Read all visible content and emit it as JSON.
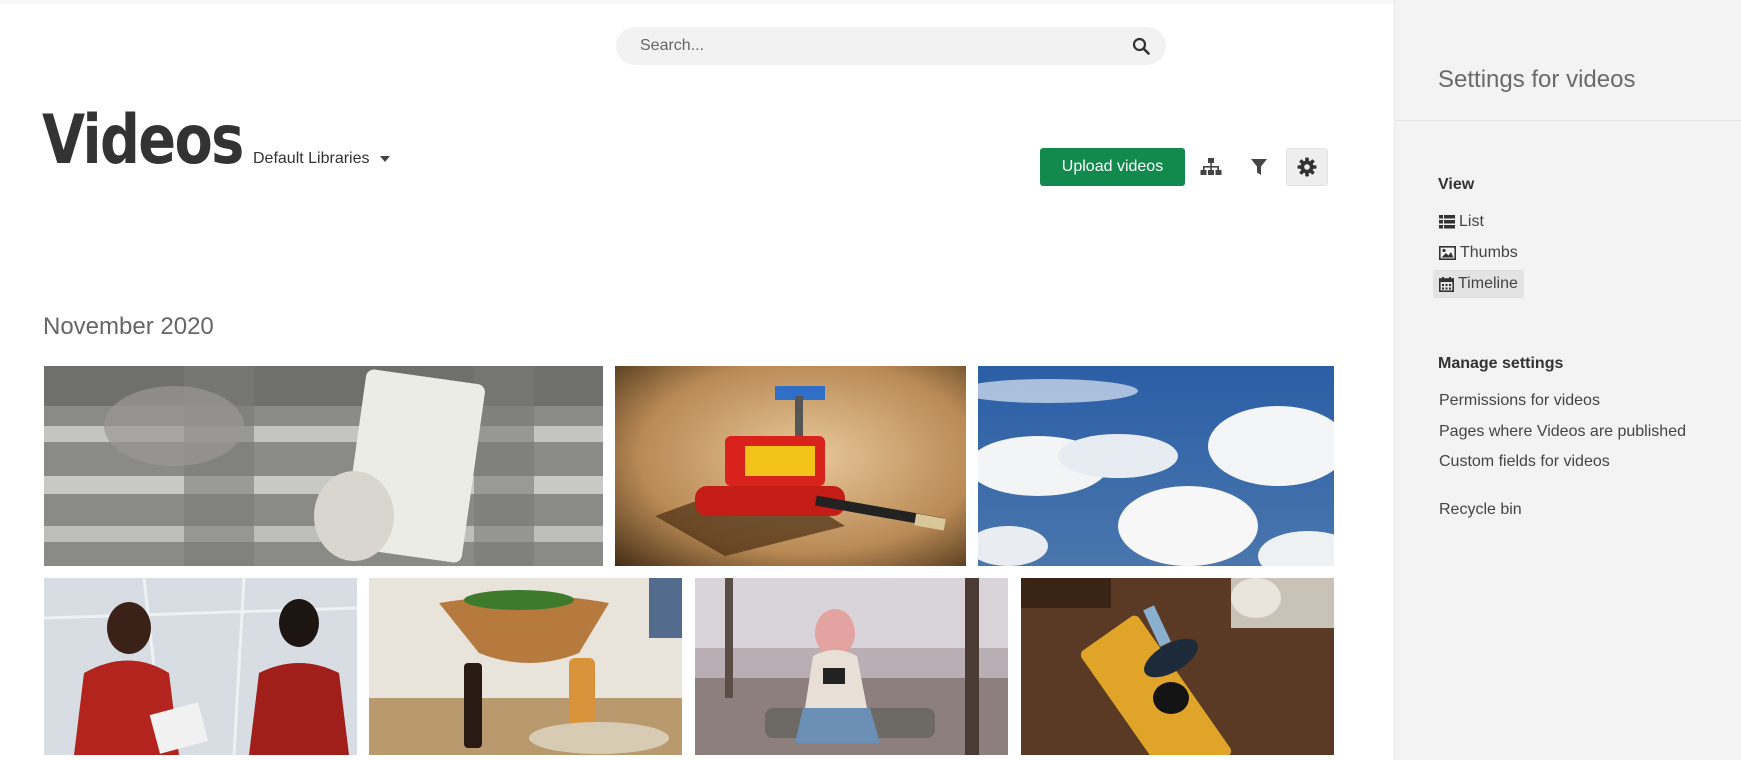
{
  "search": {
    "placeholder": "Search...",
    "icon": "search-icon"
  },
  "header": {
    "title": "Videos",
    "library_selector": "Default Libraries"
  },
  "toolbar": {
    "upload_label": "Upload videos",
    "upload_color": "#138a4d",
    "tools": [
      "hierarchy-icon",
      "filter-icon",
      "gear-icon"
    ]
  },
  "timeline": {
    "month": "November 2020",
    "thumbnails": [
      "video-thumbnail-hand-with-card",
      "video-thumbnail-lego-robot",
      "video-thumbnail-clouds",
      "video-thumbnail-women-talking",
      "video-thumbnail-salad-bowl",
      "video-thumbnail-woman-with-camera",
      "video-thumbnail-yoga-mat"
    ]
  },
  "sidebar": {
    "title": "Settings for videos",
    "view_heading": "View",
    "view_items": [
      {
        "label": "List",
        "icon": "list-icon",
        "selected": false
      },
      {
        "label": "Thumbs",
        "icon": "image-icon",
        "selected": false
      },
      {
        "label": "Timeline",
        "icon": "calendar-icon",
        "selected": true
      }
    ],
    "manage_heading": "Manage settings",
    "manage_links": [
      "Permissions for videos",
      "Pages where Videos are published",
      "Custom fields for videos"
    ],
    "recycle_bin": "Recycle bin"
  }
}
